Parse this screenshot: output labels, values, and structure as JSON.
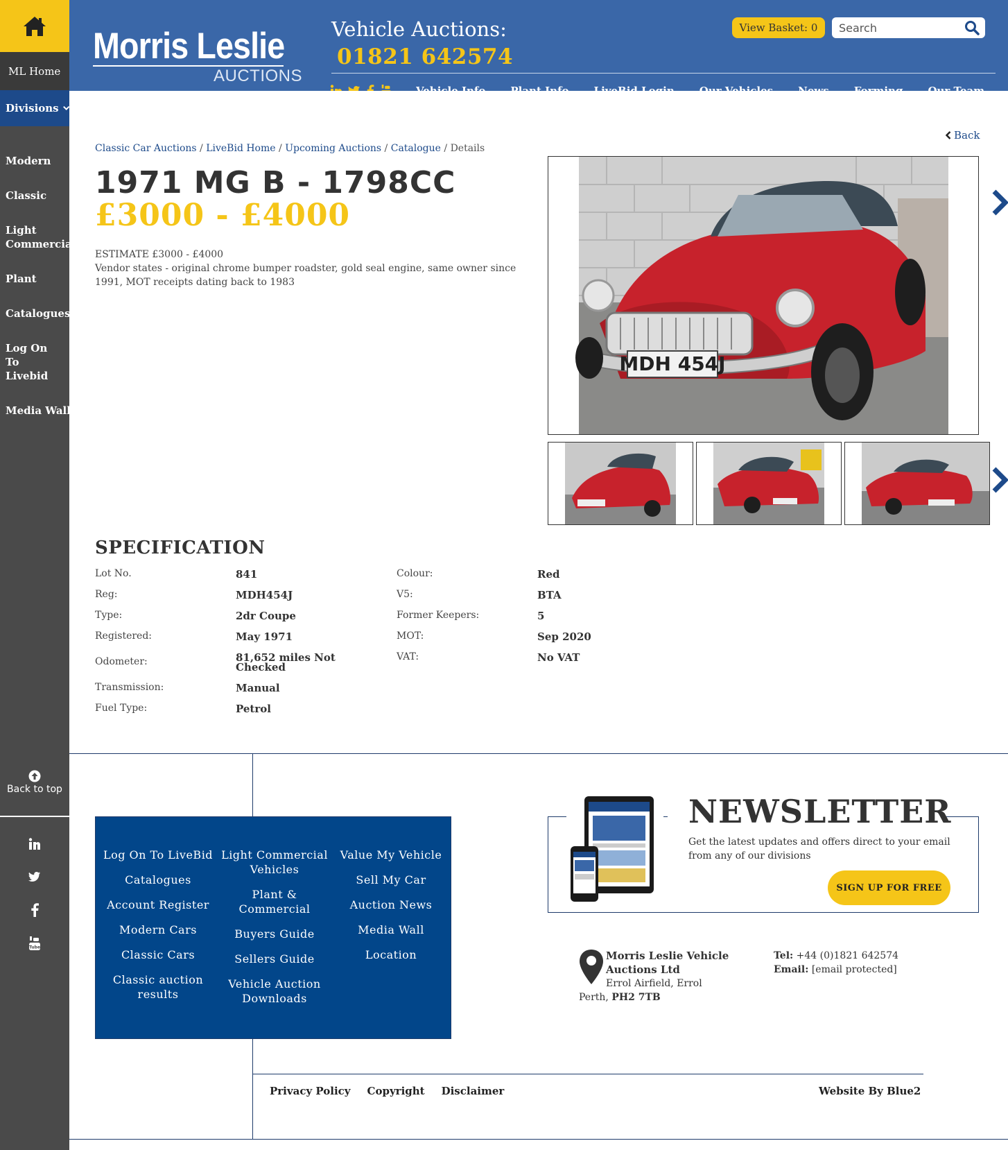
{
  "sidebar": {
    "home_icon": "home-icon",
    "ml_home": "ML Home",
    "divisions": "Divisions",
    "items": [
      "Modern",
      "Classic",
      "Light\nCommercial",
      "Plant",
      "Catalogues",
      "Log On To\nLivebid",
      "Media Wall"
    ],
    "back_to_top": "Back to top",
    "social": [
      "linkedin-icon",
      "twitter-icon",
      "facebook-icon",
      "youtube-icon"
    ]
  },
  "header": {
    "logo_name": "Morris Leslie",
    "logo_sub": "AUCTIONS",
    "title": "Vehicle Auctions:",
    "phone": "01821 642574",
    "basket_label": "View Basket:",
    "basket_count": "0",
    "search_placeholder": "Search",
    "nav": [
      "Vehicle Info",
      "Plant Info",
      "LiveBid Login",
      "Our Vehicles",
      "News",
      "Forming",
      "Our Team"
    ]
  },
  "main": {
    "back": "Back",
    "breadcrumb": [
      "Classic Car Auctions",
      "LiveBid Home",
      "Upcoming Auctions",
      "Catalogue",
      "Details"
    ],
    "title": "1971 MG B - 1798CC",
    "price": "£3000 - £4000",
    "estimate": "ESTIMATE £3000 - £4000",
    "description": "Vendor states - original chrome bumper roadster, gold seal engine, same owner since 1991, MOT receipts dating back to 1983",
    "plate": "MDH 454J"
  },
  "spec": {
    "title": "SPECIFICATION",
    "left": [
      {
        "label": "Lot No.",
        "value": "841"
      },
      {
        "label": "Reg:",
        "value": "MDH454J"
      },
      {
        "label": "Type:",
        "value": "2dr Coupe"
      },
      {
        "label": "Registered:",
        "value": "May 1971"
      },
      {
        "label": "Odometer:",
        "value": "81,652 miles Not Checked"
      },
      {
        "label": "Transmission:",
        "value": "Manual"
      },
      {
        "label": "Fuel Type:",
        "value": "Petrol"
      }
    ],
    "right": [
      {
        "label": "Colour:",
        "value": "Red"
      },
      {
        "label": "V5:",
        "value": "BTA"
      },
      {
        "label": "Former Keepers:",
        "value": "5"
      },
      {
        "label": "MOT:",
        "value": "Sep 2020"
      },
      {
        "label": "VAT:",
        "value": "No VAT"
      }
    ]
  },
  "footer": {
    "col1": [
      "Log On To LiveBid",
      "Catalogues",
      "Account Register",
      "Modern Cars",
      "Classic Cars",
      "Classic auction results"
    ],
    "col2": [
      "Light Commercial Vehicles",
      "Plant & Commercial",
      "Buyers Guide",
      "Sellers Guide",
      "Vehicle Auction Downloads"
    ],
    "col3": [
      "Value My Vehicle",
      "Sell My Car",
      "Auction News",
      "Media Wall",
      "Location"
    ],
    "newsletter_title": "NEWSLETTER",
    "newsletter_text": "Get the latest updates and offers direct to your email from any of our divisions",
    "newsletter_button": "SIGN UP FOR FREE",
    "company": "Morris Leslie Vehicle Auctions Ltd",
    "address1": "Errol Airfield, Errol",
    "address_town": "Perth,",
    "postcode": "PH2 7TB",
    "tel_label": "Tel:",
    "tel": "+44 (0)1821 642574",
    "email_label": "Email:",
    "email": "[email protected]",
    "legal": [
      "Privacy Policy",
      "Copyright",
      "Disclaimer"
    ],
    "credit": "Website By Blue2"
  },
  "colors": {
    "brand_blue": "#3a67a8",
    "accent_yellow": "#f5c518",
    "sidebar_grey": "#4a4a4a",
    "footer_blue": "#02468a"
  }
}
